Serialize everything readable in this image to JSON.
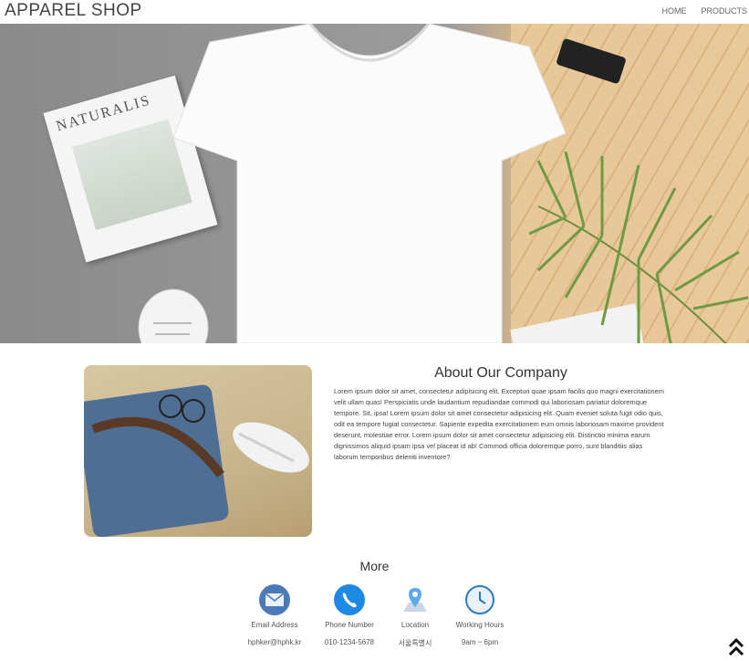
{
  "header": {
    "logo": "APPAREL SHOP",
    "nav": [
      {
        "label": "HOME"
      },
      {
        "label": "PRODUCTS"
      }
    ]
  },
  "hero": {
    "magazine_title": "NATURALIS"
  },
  "about": {
    "title": "About Our Company",
    "body": "Lorem ipsum dolor sit amet, consectetur adipisicing elit. Excepturi quae ipsam facilis quo magni exercitationem velit ullam quas! Perspiciatis unde laudantium repudiandae commodi qui laboriosam pariatur doloremque tempore. Sit, ipsa! Lorem ipsum dolor sit amet consectetur adipisicing elit. Quam eveniet soluta fugit odio quis, odit ea tempore fugiat consectetur. Sapiente expedita exercitationem eum omnis laboriosam maxime provident deserunt, molestiae error. Lorem ipsum dolor sit amet consectetur adipisicing elit. Distinctio minima earum dignissimos aliquid ipsam ipsa vel placeat id ab! Commodi officia doloremque porro, sunt blanditiis alias laborum temporibus deleniti inventore?"
  },
  "more": {
    "title": "More",
    "items": [
      {
        "icon": "email-icon",
        "label": "Email Address",
        "value": "hphker@hphk.kr"
      },
      {
        "icon": "phone-icon",
        "label": "Phone Number",
        "value": "010-1234-5678"
      },
      {
        "icon": "location-icon",
        "label": "Location",
        "value": "서울특별시"
      },
      {
        "icon": "clock-icon",
        "label": "Working Hours",
        "value": "9am ~ 6pm"
      }
    ]
  },
  "colors": {
    "accent_blue": "#1e88e5",
    "icon_blue": "#4a7ab7"
  }
}
